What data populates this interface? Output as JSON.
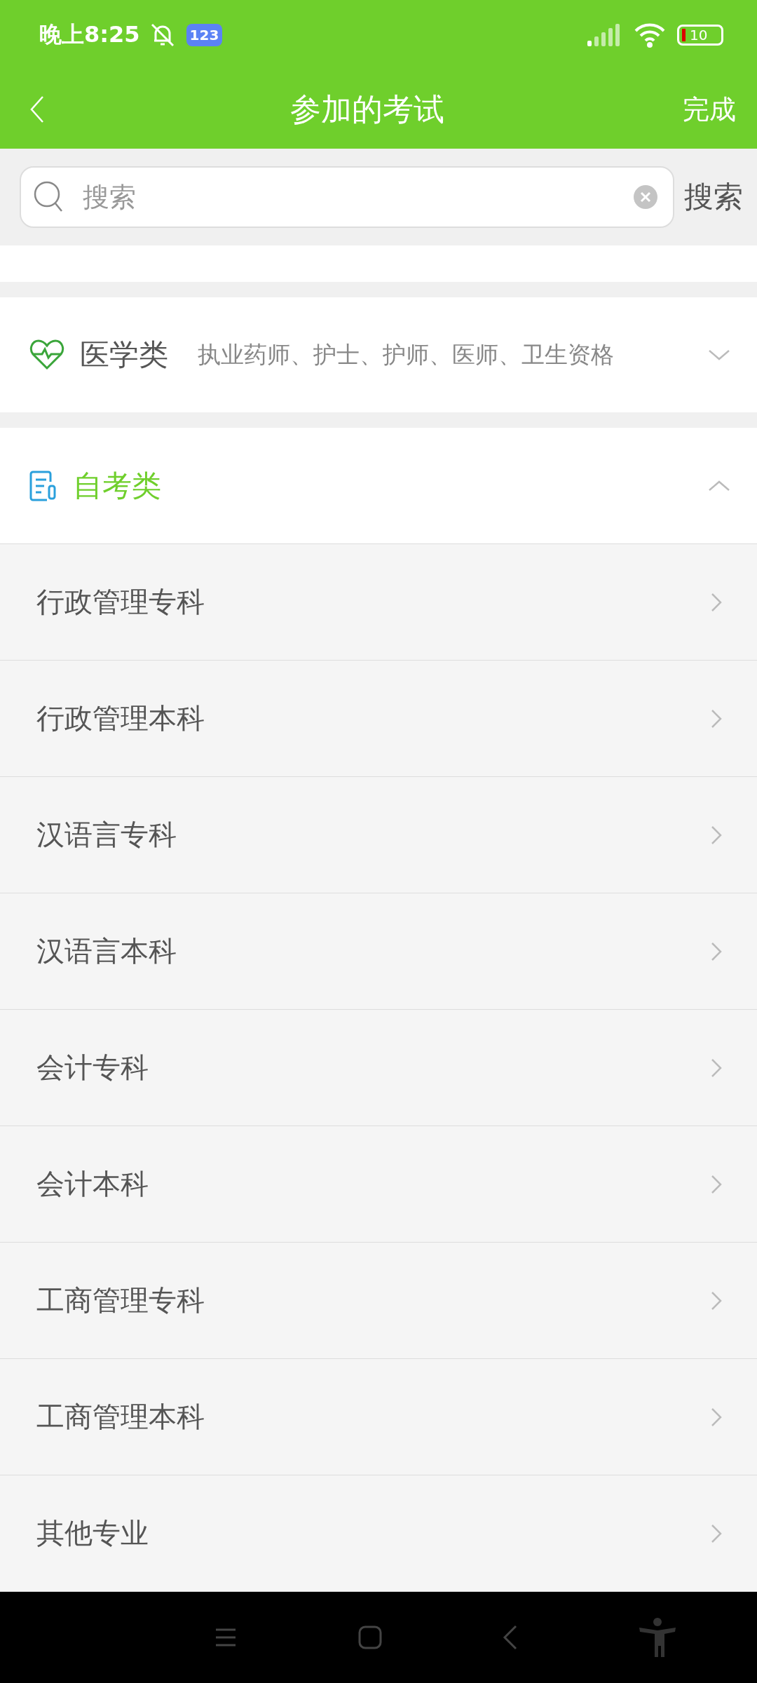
{
  "status_bar": {
    "time": "晚上8:25",
    "badge": "123",
    "battery": "10"
  },
  "header": {
    "title": "参加的考试",
    "action": "完成"
  },
  "search": {
    "placeholder": "搜索",
    "button": "搜索"
  },
  "categories": [
    {
      "kind": "medical",
      "title": "医学类",
      "subtitle": "执业药师、护士、护师、医师、卫生资格",
      "expanded": false
    },
    {
      "kind": "selfexam",
      "title": "自考类",
      "expanded": true,
      "items": [
        {
          "label": "行政管理专科"
        },
        {
          "label": "行政管理本科"
        },
        {
          "label": "汉语言专科"
        },
        {
          "label": "汉语言本科"
        },
        {
          "label": "会计专科"
        },
        {
          "label": "会计本科"
        },
        {
          "label": "工商管理专科"
        },
        {
          "label": "工商管理本科"
        },
        {
          "label": "其他专业"
        }
      ]
    }
  ]
}
